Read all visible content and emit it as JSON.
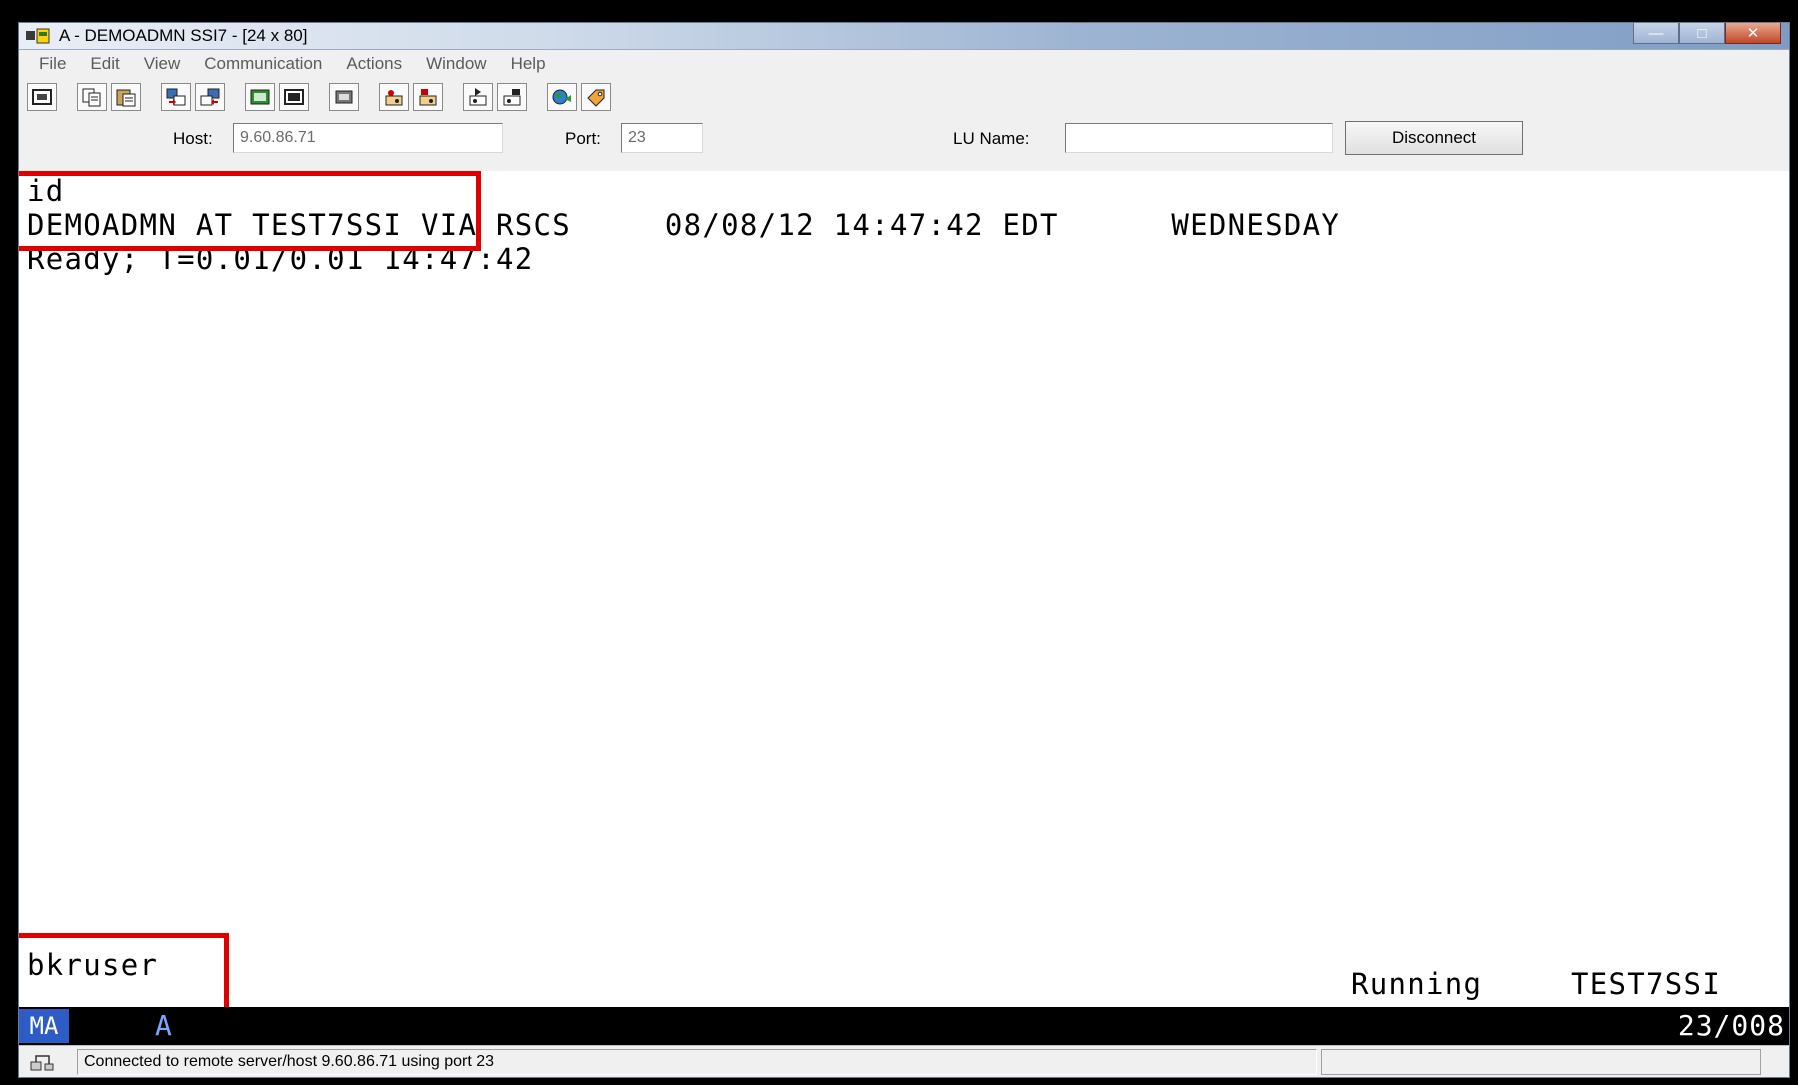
{
  "window": {
    "title": "A - DEMOADMN SSI7 - [24 x 80]"
  },
  "menu": {
    "items": [
      "File",
      "Edit",
      "View",
      "Communication",
      "Actions",
      "Window",
      "Help"
    ]
  },
  "connection": {
    "host_label": "Host:",
    "host_value": "9.60.86.71",
    "port_label": "Port:",
    "port_value": "23",
    "lu_label": "LU Name:",
    "lu_value": "",
    "disconnect_label": "Disconnect"
  },
  "terminal": {
    "line1": "id",
    "line2": "DEMOADMN AT TEST7SSI VIA RSCS     08/08/12 14:47:42 EDT      WEDNESDAY",
    "line3": "Ready; T=0.01/0.01 14:47:42",
    "input_line": "bkruser",
    "status_state": "Running",
    "status_system": "TEST7SSI"
  },
  "oia": {
    "ma": "MA",
    "a": "A",
    "cursor": "23/008"
  },
  "statusbar": {
    "message": "Connected to remote server/host 9.60.86.71 using port 23"
  },
  "colors": {
    "highlight": "#e00000",
    "oia_bg": "#000000",
    "ma_bg": "#2d5cc4"
  },
  "icons": [
    "app-icon",
    "print-screen-icon",
    "copy-icon",
    "paste-icon",
    "send-file-icon",
    "receive-file-icon",
    "display-icon",
    "keypad-icon",
    "macro-icon",
    "record-macro-icon",
    "play-macro-icon",
    "start-trace-icon",
    "stop-trace-icon",
    "globe-icon",
    "tag-icon",
    "network-icon"
  ]
}
